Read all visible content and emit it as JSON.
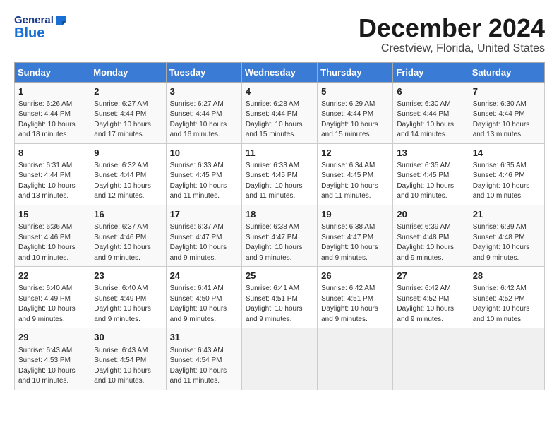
{
  "header": {
    "logo_general": "General",
    "logo_blue": "Blue",
    "month_title": "December 2024",
    "location": "Crestview, Florida, United States"
  },
  "weekdays": [
    "Sunday",
    "Monday",
    "Tuesday",
    "Wednesday",
    "Thursday",
    "Friday",
    "Saturday"
  ],
  "weeks": [
    [
      {
        "day": "1",
        "sunrise": "6:26 AM",
        "sunset": "4:44 PM",
        "daylight": "10 hours and 18 minutes."
      },
      {
        "day": "2",
        "sunrise": "6:27 AM",
        "sunset": "4:44 PM",
        "daylight": "10 hours and 17 minutes."
      },
      {
        "day": "3",
        "sunrise": "6:27 AM",
        "sunset": "4:44 PM",
        "daylight": "10 hours and 16 minutes."
      },
      {
        "day": "4",
        "sunrise": "6:28 AM",
        "sunset": "4:44 PM",
        "daylight": "10 hours and 15 minutes."
      },
      {
        "day": "5",
        "sunrise": "6:29 AM",
        "sunset": "4:44 PM",
        "daylight": "10 hours and 15 minutes."
      },
      {
        "day": "6",
        "sunrise": "6:30 AM",
        "sunset": "4:44 PM",
        "daylight": "10 hours and 14 minutes."
      },
      {
        "day": "7",
        "sunrise": "6:30 AM",
        "sunset": "4:44 PM",
        "daylight": "10 hours and 13 minutes."
      }
    ],
    [
      {
        "day": "8",
        "sunrise": "6:31 AM",
        "sunset": "4:44 PM",
        "daylight": "10 hours and 13 minutes."
      },
      {
        "day": "9",
        "sunrise": "6:32 AM",
        "sunset": "4:44 PM",
        "daylight": "10 hours and 12 minutes."
      },
      {
        "day": "10",
        "sunrise": "6:33 AM",
        "sunset": "4:45 PM",
        "daylight": "10 hours and 11 minutes."
      },
      {
        "day": "11",
        "sunrise": "6:33 AM",
        "sunset": "4:45 PM",
        "daylight": "10 hours and 11 minutes."
      },
      {
        "day": "12",
        "sunrise": "6:34 AM",
        "sunset": "4:45 PM",
        "daylight": "10 hours and 11 minutes."
      },
      {
        "day": "13",
        "sunrise": "6:35 AM",
        "sunset": "4:45 PM",
        "daylight": "10 hours and 10 minutes."
      },
      {
        "day": "14",
        "sunrise": "6:35 AM",
        "sunset": "4:46 PM",
        "daylight": "10 hours and 10 minutes."
      }
    ],
    [
      {
        "day": "15",
        "sunrise": "6:36 AM",
        "sunset": "4:46 PM",
        "daylight": "10 hours and 10 minutes."
      },
      {
        "day": "16",
        "sunrise": "6:37 AM",
        "sunset": "4:46 PM",
        "daylight": "10 hours and 9 minutes."
      },
      {
        "day": "17",
        "sunrise": "6:37 AM",
        "sunset": "4:47 PM",
        "daylight": "10 hours and 9 minutes."
      },
      {
        "day": "18",
        "sunrise": "6:38 AM",
        "sunset": "4:47 PM",
        "daylight": "10 hours and 9 minutes."
      },
      {
        "day": "19",
        "sunrise": "6:38 AM",
        "sunset": "4:47 PM",
        "daylight": "10 hours and 9 minutes."
      },
      {
        "day": "20",
        "sunrise": "6:39 AM",
        "sunset": "4:48 PM",
        "daylight": "10 hours and 9 minutes."
      },
      {
        "day": "21",
        "sunrise": "6:39 AM",
        "sunset": "4:48 PM",
        "daylight": "10 hours and 9 minutes."
      }
    ],
    [
      {
        "day": "22",
        "sunrise": "6:40 AM",
        "sunset": "4:49 PM",
        "daylight": "10 hours and 9 minutes."
      },
      {
        "day": "23",
        "sunrise": "6:40 AM",
        "sunset": "4:49 PM",
        "daylight": "10 hours and 9 minutes."
      },
      {
        "day": "24",
        "sunrise": "6:41 AM",
        "sunset": "4:50 PM",
        "daylight": "10 hours and 9 minutes."
      },
      {
        "day": "25",
        "sunrise": "6:41 AM",
        "sunset": "4:51 PM",
        "daylight": "10 hours and 9 minutes."
      },
      {
        "day": "26",
        "sunrise": "6:42 AM",
        "sunset": "4:51 PM",
        "daylight": "10 hours and 9 minutes."
      },
      {
        "day": "27",
        "sunrise": "6:42 AM",
        "sunset": "4:52 PM",
        "daylight": "10 hours and 9 minutes."
      },
      {
        "day": "28",
        "sunrise": "6:42 AM",
        "sunset": "4:52 PM",
        "daylight": "10 hours and 10 minutes."
      }
    ],
    [
      {
        "day": "29",
        "sunrise": "6:43 AM",
        "sunset": "4:53 PM",
        "daylight": "10 hours and 10 minutes."
      },
      {
        "day": "30",
        "sunrise": "6:43 AM",
        "sunset": "4:54 PM",
        "daylight": "10 hours and 10 minutes."
      },
      {
        "day": "31",
        "sunrise": "6:43 AM",
        "sunset": "4:54 PM",
        "daylight": "10 hours and 11 minutes."
      },
      null,
      null,
      null,
      null
    ]
  ],
  "labels": {
    "sunrise": "Sunrise:",
    "sunset": "Sunset:",
    "daylight": "Daylight:"
  }
}
